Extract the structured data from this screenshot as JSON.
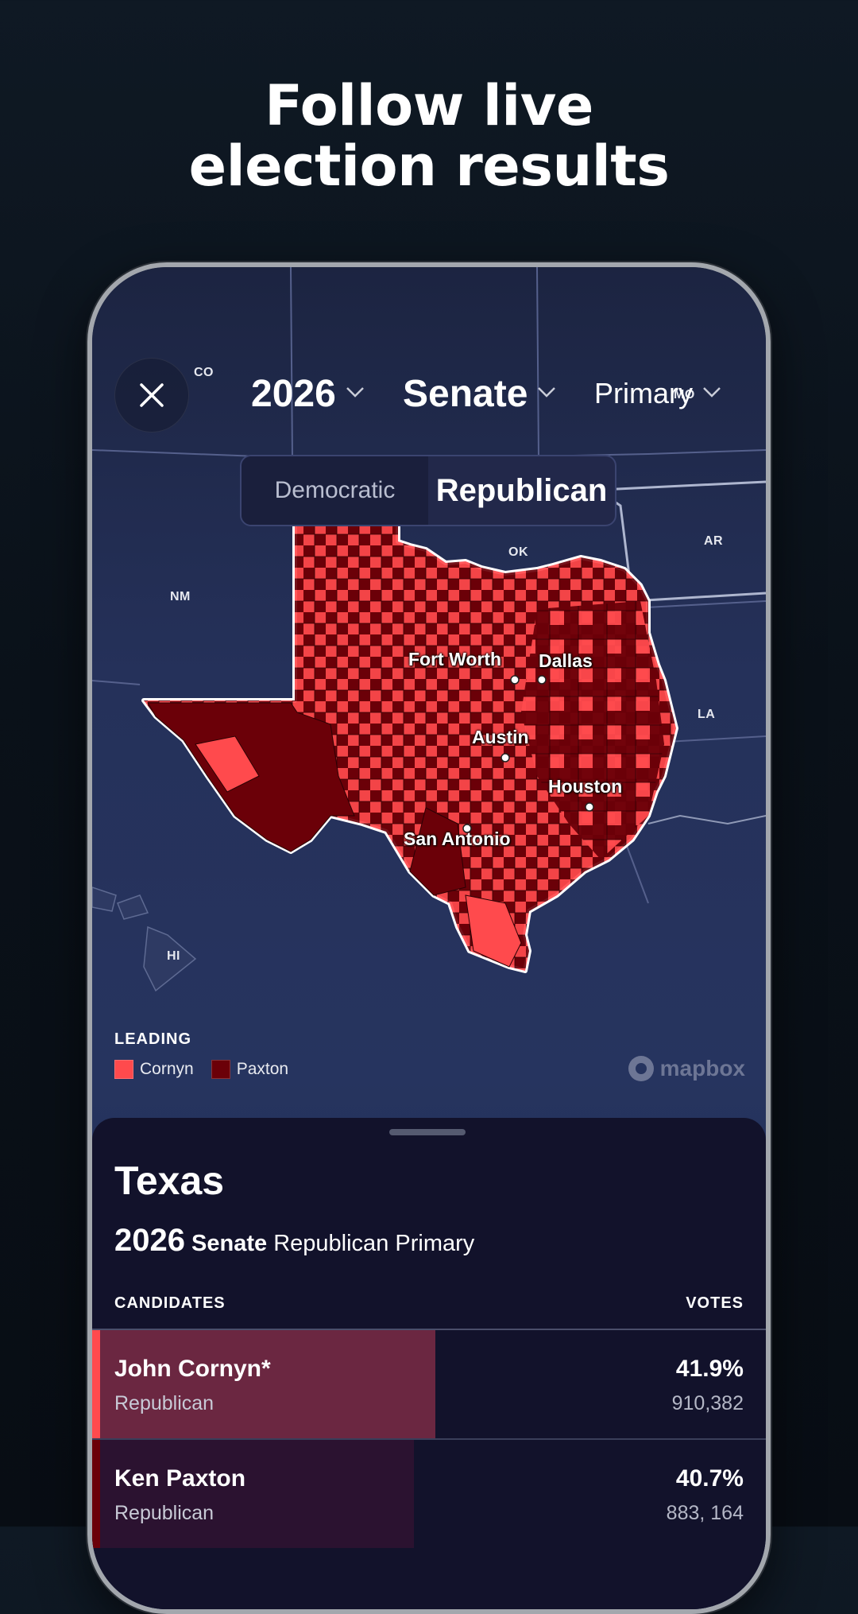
{
  "headline": {
    "line1": "Follow live",
    "line2": "election results"
  },
  "topbar": {
    "close_icon": "close-icon",
    "year": "2026",
    "office": "Senate",
    "stage": "Primary",
    "chevron_icon": "chevron-down-icon"
  },
  "party_toggle": {
    "options": [
      "Democratic",
      "Republican"
    ],
    "selected": "Republican"
  },
  "map": {
    "state_labels": [
      "CO",
      "NM",
      "OK",
      "AR",
      "LA",
      "MO",
      "HI"
    ],
    "cities": [
      "Fort Worth",
      "Dallas",
      "Austin",
      "Houston",
      "San Antonio"
    ],
    "attribution": "mapbox"
  },
  "legend": {
    "title": "LEADING",
    "items": [
      {
        "label": "Cornyn",
        "color": "#ff4a4d"
      },
      {
        "label": "Paxton",
        "color": "#6b0008"
      }
    ]
  },
  "results": {
    "state": "Texas",
    "year": "2026",
    "office": "Senate",
    "race_desc": "Republican Primary",
    "col_candidates": "CANDIDATES",
    "col_votes": "VOTES",
    "candidates": [
      {
        "name": "John Cornyn*",
        "party": "Republican",
        "pct": "41.9%",
        "votes": "910,382",
        "share": 0.419,
        "bar_color": "#6b2741",
        "accent": "#ff4a4d"
      },
      {
        "name": "Ken Paxton",
        "party": "Republican",
        "pct": "40.7%",
        "votes": "883, 164",
        "share": 0.407,
        "bar_color": "#2b1230",
        "accent": "#6b0008"
      }
    ]
  },
  "colors": {
    "cornyn": "#ff4a4d",
    "paxton": "#6b0008",
    "background": "#0a1119",
    "sheet": "#12122b"
  }
}
